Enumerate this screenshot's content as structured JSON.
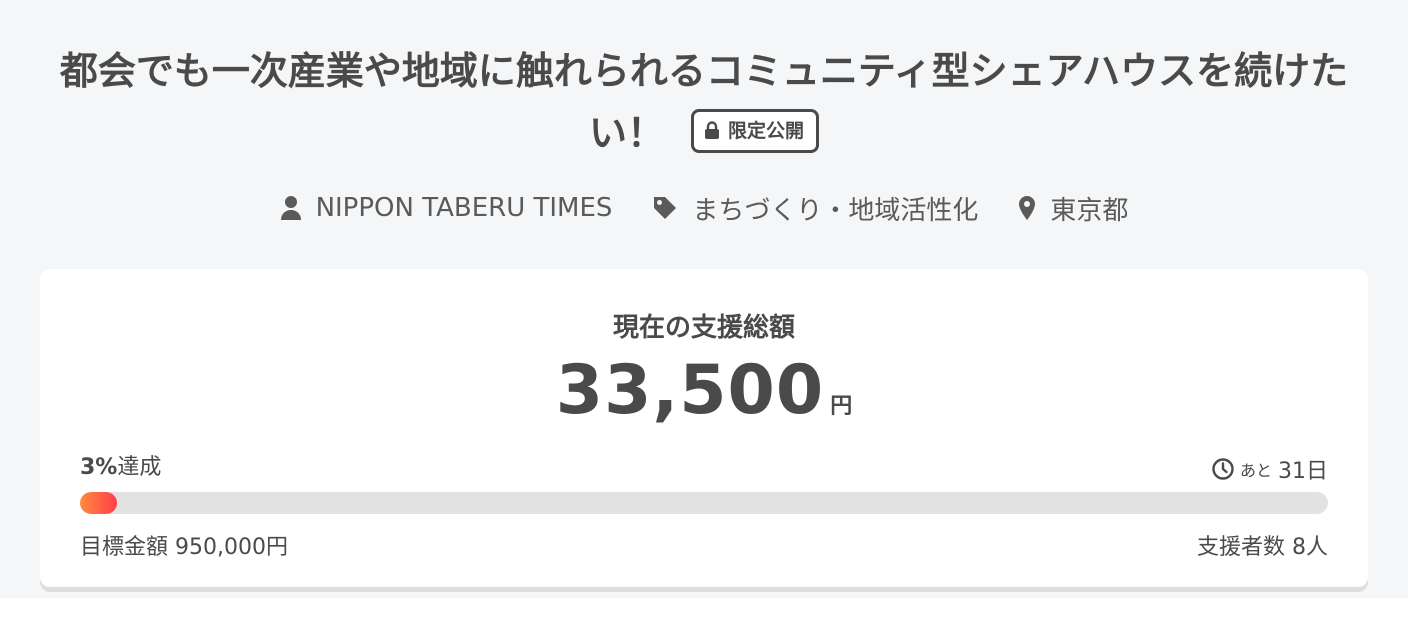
{
  "project": {
    "title": "都会でも一次産業や地域に触れられるコミュニティ型シェアハウスを続けたい！",
    "badge_label": "限定公開",
    "owner": "NIPPON TABERU TIMES",
    "category": "まちづくり・地域活性化",
    "location": "東京都"
  },
  "funding": {
    "label": "現在の支援総額",
    "amount": "33,500",
    "amount_unit": "円",
    "achieve_percent": "3%",
    "achieve_suffix": "達成",
    "progress_fraction": 0.03,
    "remaining_prefix": "あと",
    "remaining_value": "31日",
    "goal_text": "目標金額 950,000円",
    "supporters_text": "支援者数 8人"
  },
  "colors": {
    "progress_start": "#ff8a3d",
    "progress_end": "#ff3d4a",
    "track": "#e2e2e2",
    "text": "#4a4a4a"
  },
  "icons": [
    "lock-icon",
    "user-icon",
    "tag-icon",
    "location-pin-icon",
    "clock-icon"
  ]
}
